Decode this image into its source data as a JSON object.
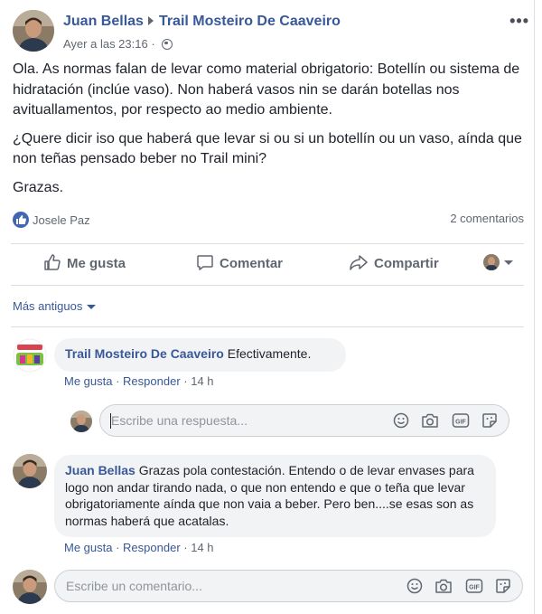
{
  "post": {
    "author": "Juan Bellas",
    "target": "Trail Mosteiro De Caaveiro",
    "timestamp": "Ayer a las 23:16",
    "more": "•••",
    "paragraphs": [
      "Ola. As normas falan de levar como material obrigatorio: Botellín ou sistema de hidratación (inclúe vaso). Non haberá vasos nin se darán botellas nos avituallamentos, por respecto ao medio ambiente.",
      "¿Quere dicir iso que haberá que levar si ou si un botellín ou un vaso, aínda que non teñas pensado beber no Trail mini?",
      "Grazas."
    ],
    "liked_by": "Josele Paz",
    "comments_count": "2 comentarios"
  },
  "actions": {
    "like": "Me gusta",
    "comment": "Comentar",
    "share": "Compartir"
  },
  "older_comments": "Más antiguos",
  "comments": [
    {
      "author": "Trail Mosteiro De Caaveiro",
      "text": "Efectivamente.",
      "like": "Me gusta",
      "reply": "Responder",
      "time": "14 h"
    },
    {
      "author": "Juan Bellas",
      "text": "Grazas pola contestación. Entendo o de levar envases para logo non andar tirando nada, o que non entendo e que o teña que levar obrigatoriamente aínda que non vaia a beber. Pero ben....se esas son as normas haberá que acatalas.",
      "like": "Me gusta",
      "reply": "Responder",
      "time": "14 h"
    }
  ],
  "reply_box": {
    "placeholder": "Escribe una respuesta..."
  },
  "comment_box": {
    "placeholder": "Escribe un comentario..."
  },
  "icons": [
    "globe-icon",
    "like-badge-icon",
    "thumbs-up-icon",
    "comment-icon",
    "share-icon",
    "emoji-icon",
    "camera-icon",
    "gif-icon",
    "sticker-icon"
  ],
  "colors": {
    "link": "#385898",
    "accent": "#4267b2",
    "muted": "#606770",
    "bubble": "#f2f3f5"
  }
}
